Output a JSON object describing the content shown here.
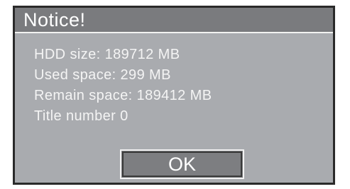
{
  "dialog": {
    "title": "Notice!",
    "lines": [
      "HDD size: 189712 MB",
      "Used space: 299 MB",
      "Remain space: 189412 MB",
      "Title number 0"
    ],
    "ok_label": "OK"
  },
  "colors": {
    "dialog_background": "#a9abaf",
    "title_bar": "#7a7b7e",
    "button_background": "#7d7e81",
    "text": "#ffffff"
  }
}
